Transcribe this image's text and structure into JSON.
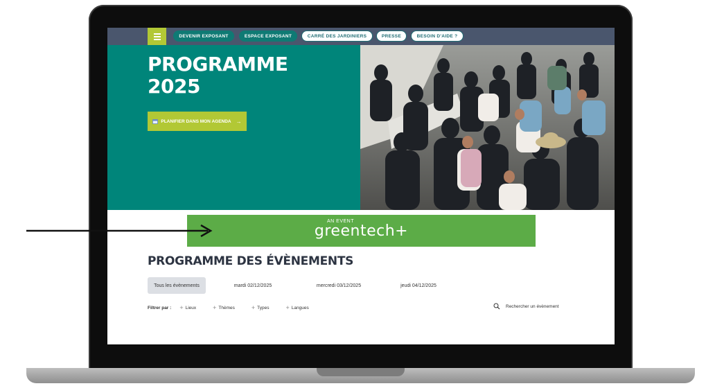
{
  "nav": {
    "items": [
      {
        "label": "DEVENIR EXPOSANT",
        "style": "dark"
      },
      {
        "label": "ESPACE EXPOSANT",
        "style": "dark"
      },
      {
        "label": "CARRÉ DES JARDINIERS",
        "style": "light"
      },
      {
        "label": "PRESSE",
        "style": "light"
      },
      {
        "label": "BESOIN D'AIDE ?",
        "style": "light"
      }
    ]
  },
  "hero": {
    "title_line1": "PROGRAMME",
    "title_line2": "2025",
    "agenda_button": "PLANIFIER DANS MON AGENDA",
    "agenda_arrow": "→"
  },
  "banner": {
    "small": "AN EVENT",
    "logo": "greentech+"
  },
  "programme": {
    "title": "PROGRAMME DES ÉVÈNEMENTS",
    "tabs": [
      "Tous les évènements",
      "mardi 02/12/2025",
      "mercredi 03/12/2025",
      "jeudi 04/12/2025"
    ],
    "filter_label": "Filtrer par :",
    "filters": [
      "Lieux",
      "Thèmes",
      "Types",
      "Langues"
    ],
    "search_placeholder": "Rechercher un évènement"
  },
  "colors": {
    "navbar": "#4a566d",
    "teal": "#00857a",
    "lime": "#b2c835",
    "banner_green": "#5cac47"
  }
}
